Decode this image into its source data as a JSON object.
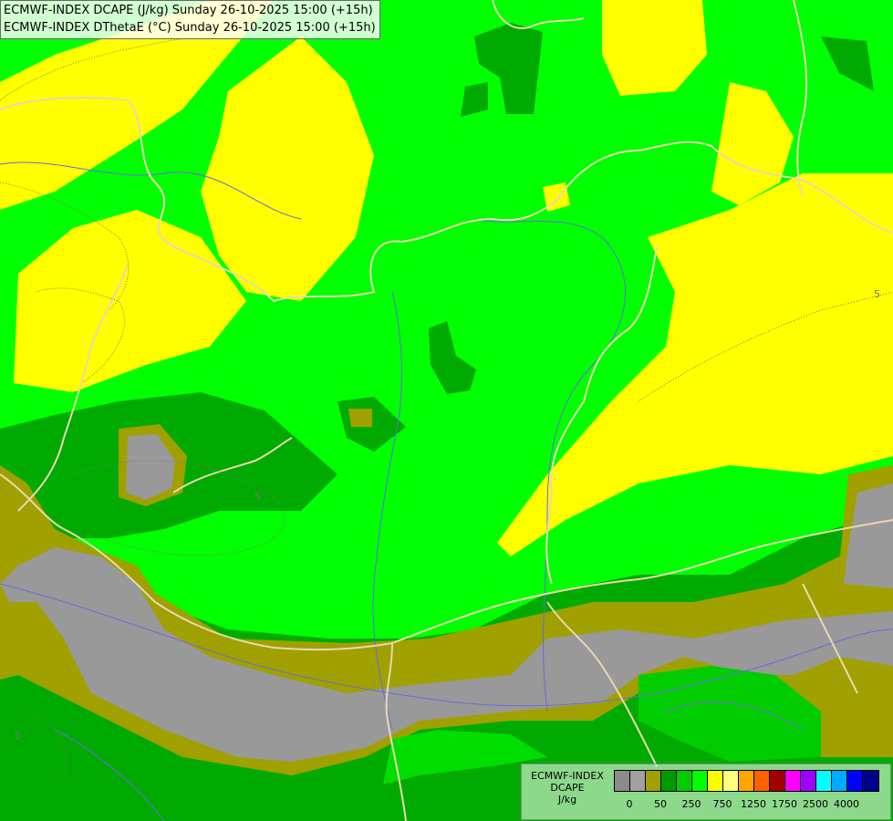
{
  "titles": {
    "line1": "ECMWF-INDEX DCAPE (J/kg) Sunday 26-10-2025 15:00 (+15h)",
    "line2": "ECMWF-INDEX DThetaE (°C) Sunday 26-10-2025 15:00 (+15h)"
  },
  "contour_labels": [
    "5",
    "5",
    "5"
  ],
  "legend": {
    "title": "ECMWF-INDEX",
    "subtitle": "DCAPE",
    "unit": "J/kg",
    "colors": [
      "#8c8c8c",
      "#a0a0a0",
      "#a0a000",
      "#009900",
      "#00cc00",
      "#00ff00",
      "#ffff00",
      "#ffff80",
      "#ffa500",
      "#ff6000",
      "#a00000",
      "#ff00ff",
      "#a000ff",
      "#00ffff",
      "#00aaff",
      "#0000ff",
      "#00008b"
    ],
    "tick_labels": [
      "0",
      "50",
      "250",
      "750",
      "1250",
      "1750",
      "2500",
      "4000"
    ]
  },
  "palette": {
    "gray": "#999999",
    "olive": "#a0a000",
    "dark_green": "#009900",
    "green": "#00cc00",
    "light_green": "#00ff00",
    "yellow": "#ffff00",
    "border": "#e8d8b0",
    "river": "#6a6adc"
  }
}
